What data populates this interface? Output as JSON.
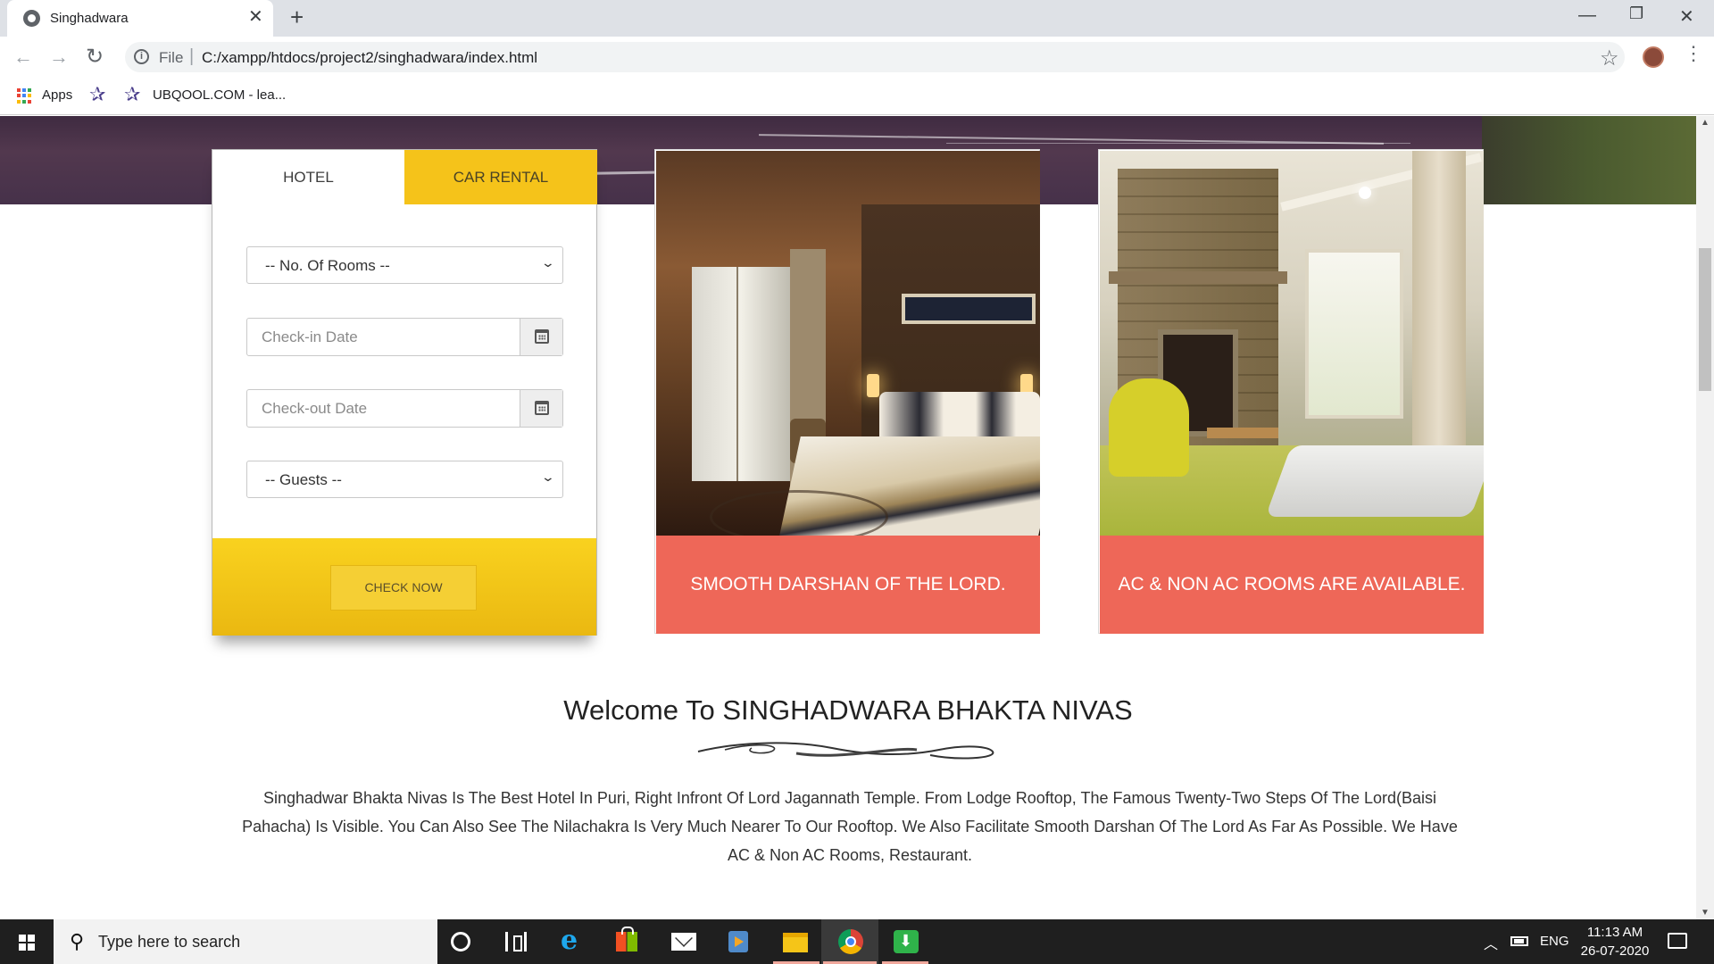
{
  "browser": {
    "tab_title": "Singhadwara",
    "tab_close_glyph": "✕",
    "new_tab_glyph": "+",
    "window_controls": {
      "minimize": "—",
      "maximize": "❐",
      "close": "✕"
    },
    "address": {
      "scheme_label": "File",
      "separator": "|",
      "url": "C:/xampp/htdocs/project2/singhadwara/index.html"
    },
    "bookmarks": {
      "apps_label": "Apps",
      "item_label": "UBQOOL.COM - lea..."
    },
    "icons": [
      "back-icon",
      "forward-icon",
      "reload-icon",
      "info-icon",
      "star-icon",
      "profile-avatar",
      "menu-icon"
    ]
  },
  "booking": {
    "tabs": {
      "hotel": "HOTEL",
      "car_rental": "CAR RENTAL"
    },
    "rooms_select": "-- No. Of Rooms --",
    "checkin_placeholder": "Check-in Date",
    "checkout_placeholder": "Check-out Date",
    "guests_select": "-- Guests --",
    "submit_label": "CHECK NOW",
    "accent_color": "#f5c31a"
  },
  "features": [
    {
      "caption": "SMOOTH DARSHAN OF THE LORD.",
      "photo": "hotel-bedroom-photo"
    },
    {
      "caption": "AC & NON AC ROOMS ARE AVAILABLE.",
      "photo": "living-room-photo"
    }
  ],
  "feature_color": "#ee6758",
  "welcome": {
    "title": "Welcome To SINGHADWARA BHAKTA NIVAS",
    "text": "Singhadwar Bhakta Nivas Is The Best Hotel In Puri, Right Infront Of Lord Jagannath Temple. From Lodge Rooftop, The Famous Twenty-Two Steps Of The Lord(Baisi Pahacha) Is Visible. You Can Also See The Nilachakra Is Very Much Nearer To Our Rooftop. We Also Facilitate Smooth Darshan Of The Lord As Far As Possible. We Have AC & Non AC Rooms, Restaurant."
  },
  "taskbar": {
    "search_placeholder": "Type here to search",
    "language": "ENG",
    "time": "11:13 AM",
    "date": "26-07-2020",
    "pinned": [
      "cortana-icon",
      "task-view-icon",
      "edge-icon",
      "store-icon",
      "mail-icon",
      "media-player-icon",
      "file-explorer-icon",
      "chrome-icon",
      "download-app-icon"
    ]
  }
}
